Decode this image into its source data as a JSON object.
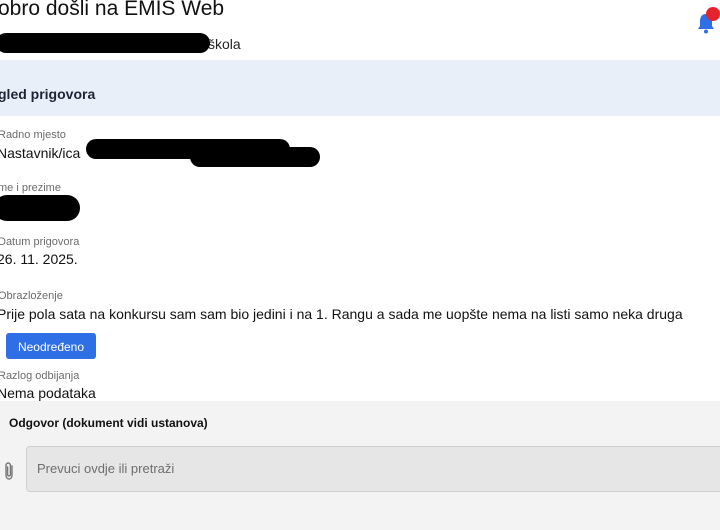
{
  "header": {
    "welcome": "obro došli na  EMIS Web",
    "school_suffix": "škola",
    "notification_icon": "bell-icon",
    "notification_dot_color": "#e5232e"
  },
  "section": {
    "title": "gled prigovora"
  },
  "fields": {
    "position": {
      "label": "Radno mjesto",
      "value": "Nastavnik/ica"
    },
    "name": {
      "label": "me i prezime",
      "value": ""
    },
    "date": {
      "label": "Datum prigovora",
      "value": "26. 11. 2025."
    },
    "explanation": {
      "label": "Obrazloženje",
      "value": "Prije pola sata na konkursu sam sam bio jedini i na 1. Rangu a sada me uopšte nema na listi samo neka druga"
    },
    "status_button": "Neodređeno",
    "rejection": {
      "label": "Razlog odbijanja",
      "value": "Nema podataka"
    }
  },
  "answer": {
    "title": "Odgovor (dokument vidi ustanova)",
    "attach_icon": "paperclip-icon",
    "placeholder": "Prevuci ovdje ili pretraži"
  },
  "colors": {
    "accent": "#2f6fe6",
    "section_bg": "#e9eff8"
  }
}
